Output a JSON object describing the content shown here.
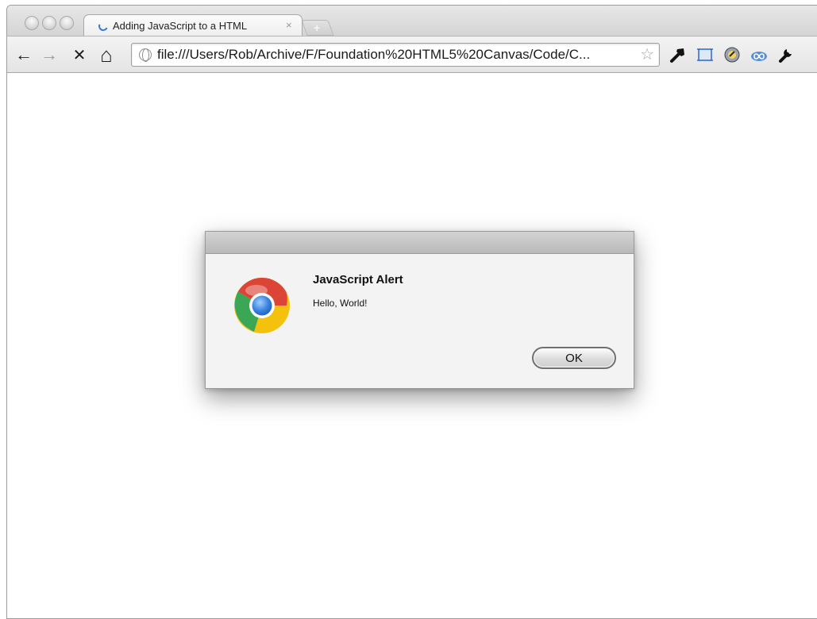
{
  "window": {
    "tab": {
      "title": "Adding JavaScript to a HTML",
      "close_icon": "×",
      "new_tab_icon": "+"
    }
  },
  "toolbar": {
    "back_icon": "←",
    "forward_icon": "→",
    "stop_icon": "✕",
    "home_icon": "⌂",
    "url": "file:///Users/Rob/Archive/F/Foundation%20HTML5%20Canvas/Code/C...",
    "bookmark_star": "☆"
  },
  "dialog": {
    "title": "JavaScript Alert",
    "message": "Hello, World!",
    "ok_label": "OK"
  },
  "colors": {
    "chrome_red": "#db4437",
    "chrome_green": "#3aa757",
    "chrome_yellow": "#f4c20d",
    "chrome_blue": "#3b82e0"
  }
}
